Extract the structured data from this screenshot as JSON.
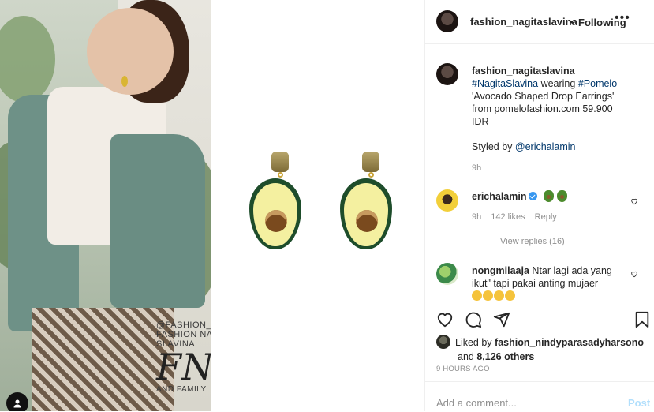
{
  "header": {
    "username": "fashion_nagitaslavina",
    "separator": "•",
    "follow_state": "Following",
    "more_icon": "more-icon"
  },
  "caption": {
    "username": "fashion_nagitaslavina",
    "hashtag1": "#NagitaSlavina",
    "word1": " wearing ",
    "hashtag2": "#Pomelo",
    "line2": "'Avocado Shaped Drop Earrings'",
    "line3": "from pomelofashion.com 59.900",
    "line4": "IDR",
    "styled_prefix": "Styled by ",
    "styled_mention": "@erichalamin",
    "time": "9h"
  },
  "comments": [
    {
      "username": "erichalamin",
      "verified": true,
      "emojis": [
        "avocado",
        "avocado"
      ],
      "time": "9h",
      "likes": "142 likes",
      "reply": "Reply",
      "view_replies": "View replies (16)"
    },
    {
      "username": "nongmilaaja",
      "text": "Ntar lagi ada yang ikut\" tapi pakai anting mujaer",
      "emojis": [
        "laughing",
        "laughing",
        "laughing",
        "laughing"
      ]
    }
  ],
  "photo_watermark": {
    "line1": "@FASHION_NAGITASLAVINA",
    "line2": "FASHION NAGITA SLAVINA",
    "logo": "FNS",
    "line3": "AND FAMILY"
  },
  "likes": {
    "prefix": "Liked by ",
    "user": "fashion_nindyparasadyharsono",
    "and": "and ",
    "others": "8,126 others"
  },
  "time_ago": "9 HOURS AGO",
  "add_comment": {
    "placeholder": "Add a comment...",
    "post_label": "Post"
  },
  "colors": {
    "link": "#00376b",
    "verified": "#3897f0",
    "muted": "#8e8e8e",
    "post_disabled": "#b2dffc"
  }
}
